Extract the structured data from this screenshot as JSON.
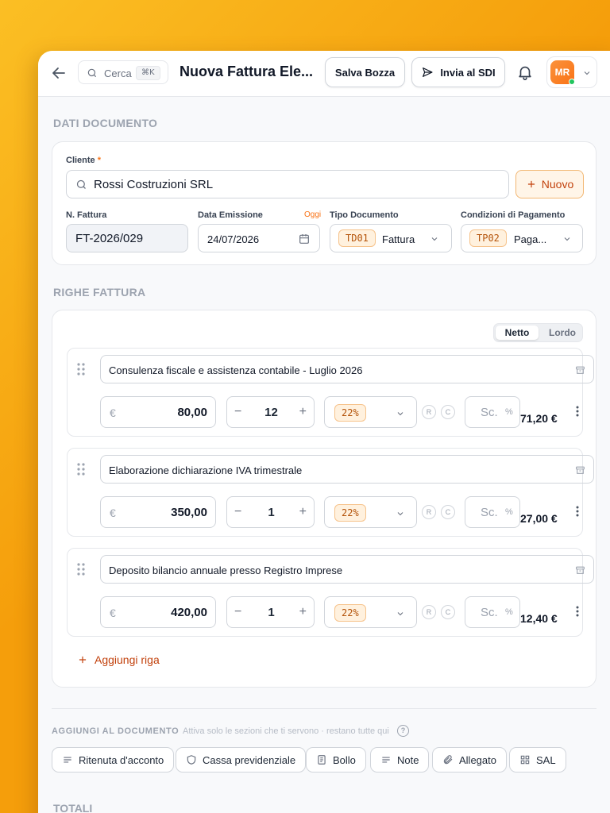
{
  "header": {
    "title": "Nuova Fattura Ele...",
    "search_label": "Cerca",
    "search_shortcut": "⌘K",
    "save_draft": "Salva Bozza",
    "send_sdi": "Invia al SDI",
    "user_initials": "MR"
  },
  "documento": {
    "section_title": "DATI DOCUMENTO",
    "cliente_label": "Cliente",
    "cliente_required": "*",
    "cliente_value": "Rossi Costruzioni SRL",
    "nuovo_button": "Nuovo",
    "numero_label": "N. Fattura",
    "numero_value": "FT-2026/029",
    "data_label": "Data Emissione",
    "oggi": "Oggi",
    "data_value": "24/07/2026",
    "tipo_label": "Tipo Documento",
    "tipo_code": "TD01",
    "tipo_value": "Fattura",
    "pagamento_label": "Condizioni di Pagamento",
    "pagamento_code": "TP02",
    "pagamento_value": "Paga..."
  },
  "righe": {
    "section_title": "RIGHE FATTURA",
    "toggle_on": "Netto",
    "toggle_off": "Lordo",
    "currency": "€",
    "discount_placeholder": "Sc.",
    "percent": "%",
    "flag_r": "R",
    "flag_c": "C",
    "add_row": "Aggiungi riga",
    "items": [
      {
        "description": "Consulenza fiscale e assistenza contabile - Luglio 2026",
        "price": "80,00",
        "qty": "12",
        "vat": "22%",
        "total": "71,20 €"
      },
      {
        "description": "Elaborazione dichiarazione IVA trimestrale",
        "price": "350,00",
        "qty": "1",
        "vat": "22%",
        "total": "27,00 €"
      },
      {
        "description": "Deposito bilancio annuale presso Registro Imprese",
        "price": "420,00",
        "qty": "1",
        "vat": "22%",
        "total": "12,40 €"
      }
    ]
  },
  "addons": {
    "title": "AGGIUNGI AL DOCUMENTO",
    "hint": "Attiva solo le sezioni che ti servono · restano tutte qui",
    "help": "?",
    "chips": [
      "Ritenuta d'acconto",
      "Cassa previdenziale",
      "Bollo",
      "Note",
      "Allegato",
      "SAL"
    ]
  },
  "totali": {
    "section_title": "TOTALI"
  },
  "colors": {
    "accent": "#f97316",
    "background": "#f59e0b"
  }
}
